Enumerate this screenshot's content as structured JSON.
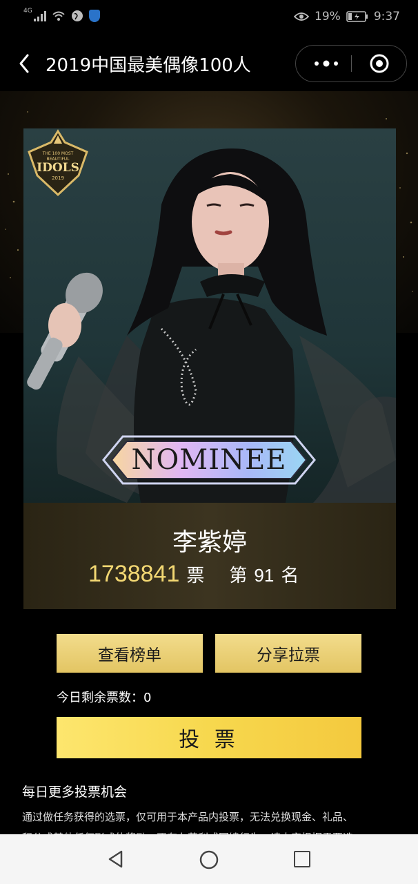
{
  "status_bar": {
    "network": "4G",
    "battery": "19%",
    "time": "9:37"
  },
  "header": {
    "title": "2019中国最美偶像100人"
  },
  "hero": {
    "badge_icon": "idols-2019-badge",
    "nominee_label": "NOMINEE"
  },
  "candidate": {
    "name": "李紫婷",
    "votes": "1738841",
    "votes_unit": "票",
    "rank_prefix": "第",
    "rank": "91",
    "rank_suffix": "名"
  },
  "actions": {
    "view_list": "查看榜单",
    "share": "分享拉票",
    "remaining_label": "今日剩余票数：",
    "remaining_value": "0",
    "vote": "投 票"
  },
  "more": {
    "title": "每日更多投票机会",
    "rules_line1": "通过做任务获得的选票，仅可用于本产品内投票，无法兑换现金、礼品、",
    "rules_line2": "积分或其他任何形式的奖励，不存在获利或回馈行为，请大家根据需要选"
  },
  "colors": {
    "accent_gold": "#f3d873",
    "vote_button": "#f7d84e",
    "info_panel": "#3c3420"
  }
}
